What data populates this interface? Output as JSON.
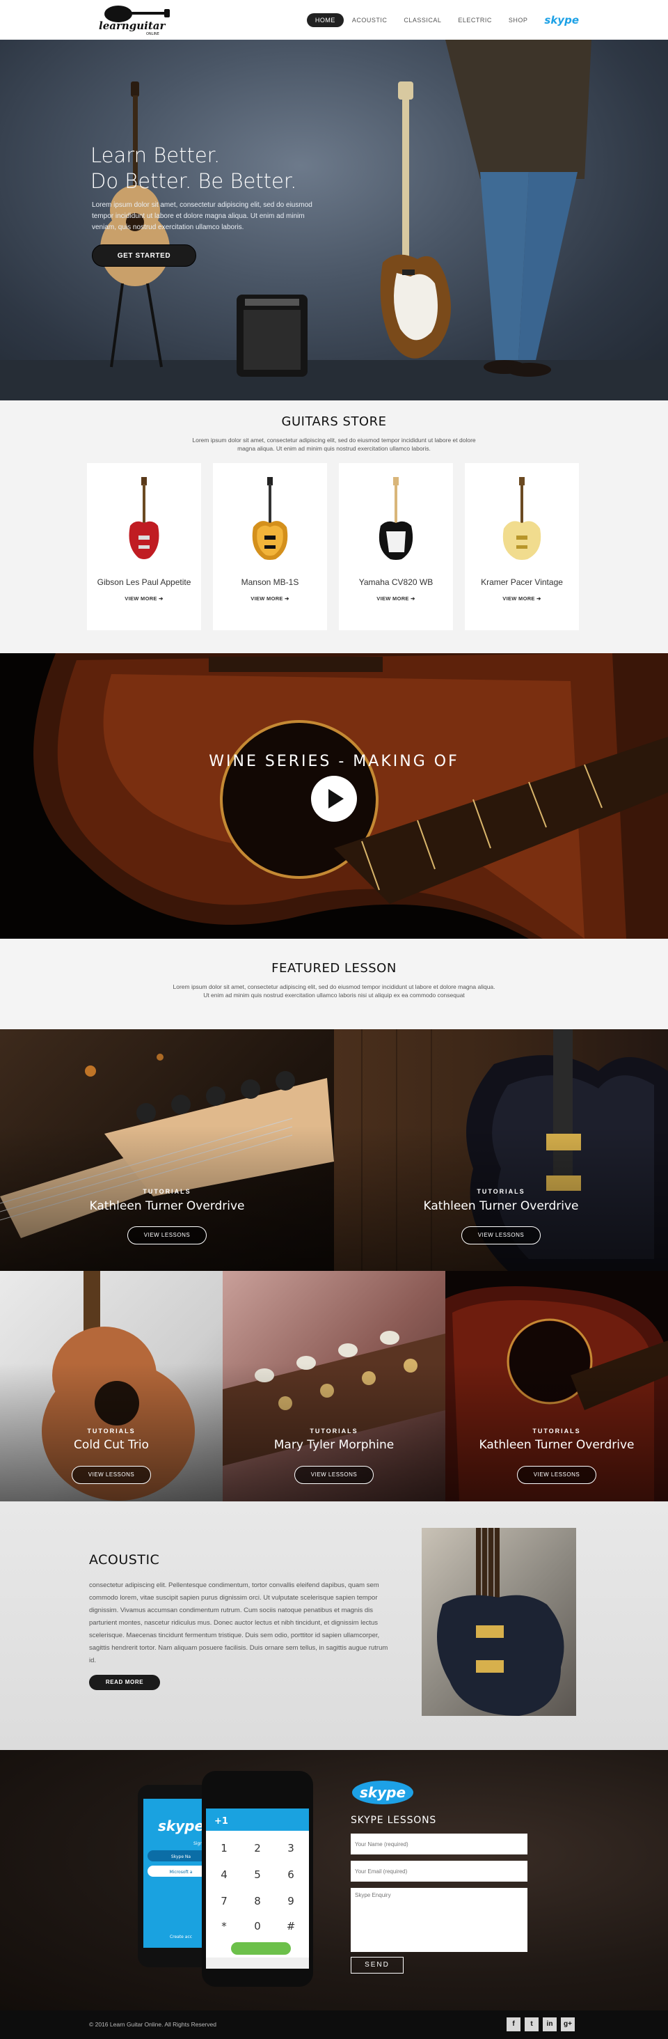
{
  "brand": {
    "logo_text": "learnguitar",
    "logo_sub": "ONLINE"
  },
  "nav": {
    "items": [
      "HOME",
      "ACOUSTIC",
      "CLASSICAL",
      "ELECTRIC",
      "SHOP"
    ],
    "skype": "skype"
  },
  "hero": {
    "title_line1": "Learn Better.",
    "title_line2": "Do Better. Be Better.",
    "text": "Lorem ipsum dolor sit amet, consectetur adipiscing elit, sed do eiusmod tempor incididunt ut labore et dolore magna aliqua. Ut enim ad minim veniam, quis nostrud exercitation ullamco laboris.",
    "button": "GET STARTED"
  },
  "store": {
    "title": "GUITARS STORE",
    "subtitle_line1": "Lorem ipsum dolor sit amet, consectetur adipiscing elit, sed do eiusmod tempor incididunt ut labore et dolore",
    "subtitle_line2": "magna aliqua. Ut enim ad minim quis nostrud exercitation ullamco laboris.",
    "products": [
      {
        "name": "Gibson Les Paul Appetite",
        "more": "VIEW MORE"
      },
      {
        "name": "Manson MB-1S",
        "more": "VIEW MORE"
      },
      {
        "name": "Yamaha CV820 WB",
        "more": "VIEW MORE"
      },
      {
        "name": "Kramer Pacer Vintage",
        "more": "VIEW MORE"
      }
    ]
  },
  "video": {
    "title": "WINE SERIES - MAKING OF"
  },
  "featured": {
    "title": "FEATURED LESSON",
    "subtitle_line1": "Lorem ipsum dolor sit amet, consectetur adipiscing elit, sed do eiusmod tempor incididunt ut labore et dolore magna aliqua.",
    "subtitle_line2": "Ut enim ad minim quis nostrud exercitation ullamco laboris nisi ut aliquip ex ea commodo consequat",
    "lessons": [
      {
        "tag": "TUTORIALS",
        "name": "Kathleen Turner Overdrive",
        "button": "VIEW LESSONS"
      },
      {
        "tag": "TUTORIALS",
        "name": "Kathleen Turner Overdrive",
        "button": "VIEW LESSONS"
      },
      {
        "tag": "TUTORIALS",
        "name": "Cold Cut Trio",
        "button": "VIEW LESSONS"
      },
      {
        "tag": "TUTORIALS",
        "name": "Mary Tyler Morphine",
        "button": "VIEW LESSONS"
      },
      {
        "tag": "TUTORIALS",
        "name": "Kathleen Turner Overdrive",
        "button": "VIEW LESSONS"
      }
    ]
  },
  "acoustic": {
    "title": "ACOUSTIC",
    "text": "consectetur adipiscing elit. Pellentesque condimentum, tortor convallis eleifend dapibus, quam sem commodo lorem, vitae suscipit sapien purus dignissim orci. Ut vulputate scelerisque sapien tempor dignissim. Vivamus accumsan condimentum rutrum. Cum sociis natoque penatibus et magnis dis parturient montes, nascetur ridiculus mus. Donec auctor lectus et nibh tincidunt, et dignissim lectus scelerisque. Maecenas tincidunt fermentum tristique. Duis sem odio, porttitor id sapien ullamcorper, sagittis hendrerit tortor. Nam aliquam posuere facilisis. Duis ornare sem tellus, in sagittis augue rutrum id.",
    "button": "READ MORE"
  },
  "skype_section": {
    "logo": "skype",
    "title": "SKYPE LESSONS",
    "name_placeholder": "Your Name (required)",
    "email_placeholder": "Your Email (required)",
    "enquiry_placeholder": "Skype Enquiry",
    "send": "SEND",
    "phone": {
      "call_number": "+1",
      "keys": [
        "1",
        "2",
        "3",
        "4",
        "5",
        "6",
        "7",
        "8",
        "9",
        "*",
        "0",
        "#"
      ],
      "tablet_items": [
        "Skype Na",
        "Microsoft a"
      ],
      "tablet_sign": "Sign in",
      "tablet_create": "Create acc"
    }
  },
  "footer": {
    "copyright": "© 2016 Learn Guitar Online. All Rights Reserved",
    "socials": [
      "f",
      "t",
      "in",
      "g+"
    ]
  },
  "colors": {
    "skype_blue": "#1da1e6",
    "dark": "#1b1b1b"
  }
}
